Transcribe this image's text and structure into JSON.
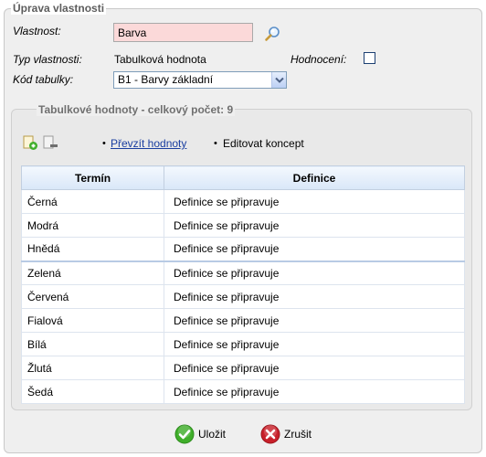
{
  "section": {
    "title": "Úprava vlastnosti",
    "property_label": "Vlastnost:",
    "property_value": "Barva",
    "type_label": "Typ vlastnosti:",
    "type_value": "Tabulková hodnota",
    "rating_label": "Hodnocení:",
    "rating_checked": false,
    "table_code_label": "Kód tabulky:",
    "table_code_selected": "B1 - Barvy základní"
  },
  "values_panel": {
    "title": "Tabulkové hodnoty - celkový počet: 9",
    "take_values_link": "Převzít hodnoty",
    "edit_concept": "Editovat koncept",
    "bullet": "•",
    "columns": {
      "term": "Termín",
      "definition": "Definice"
    },
    "rows": [
      {
        "term": "Černá",
        "definition": "Definice se připravuje"
      },
      {
        "term": "Modrá",
        "definition": "Definice se připravuje"
      },
      {
        "term": "Hnědá",
        "definition": "Definice se připravuje"
      },
      {
        "term": "Zelená",
        "definition": "Definice se připravuje"
      },
      {
        "term": "Červená",
        "definition": "Definice se připravuje"
      },
      {
        "term": "Fialová",
        "definition": "Definice se připravuje"
      },
      {
        "term": "Bílá",
        "definition": "Definice se připravuje"
      },
      {
        "term": "Žlutá",
        "definition": "Definice se připravuje"
      },
      {
        "term": "Šedá",
        "definition": "Definice se připravuje"
      }
    ]
  },
  "buttons": {
    "save": "Uložit",
    "cancel": "Zrušit"
  },
  "icons": {
    "search": "magnifier-icon",
    "add": "add-row-icon",
    "remove": "remove-row-icon",
    "save": "check-icon",
    "cancel": "close-icon"
  },
  "colors": {
    "required_field_bg": "#fbd9d9",
    "link": "#1a3ea0",
    "save_green": "#3fae2a",
    "cancel_red": "#c8202a"
  }
}
